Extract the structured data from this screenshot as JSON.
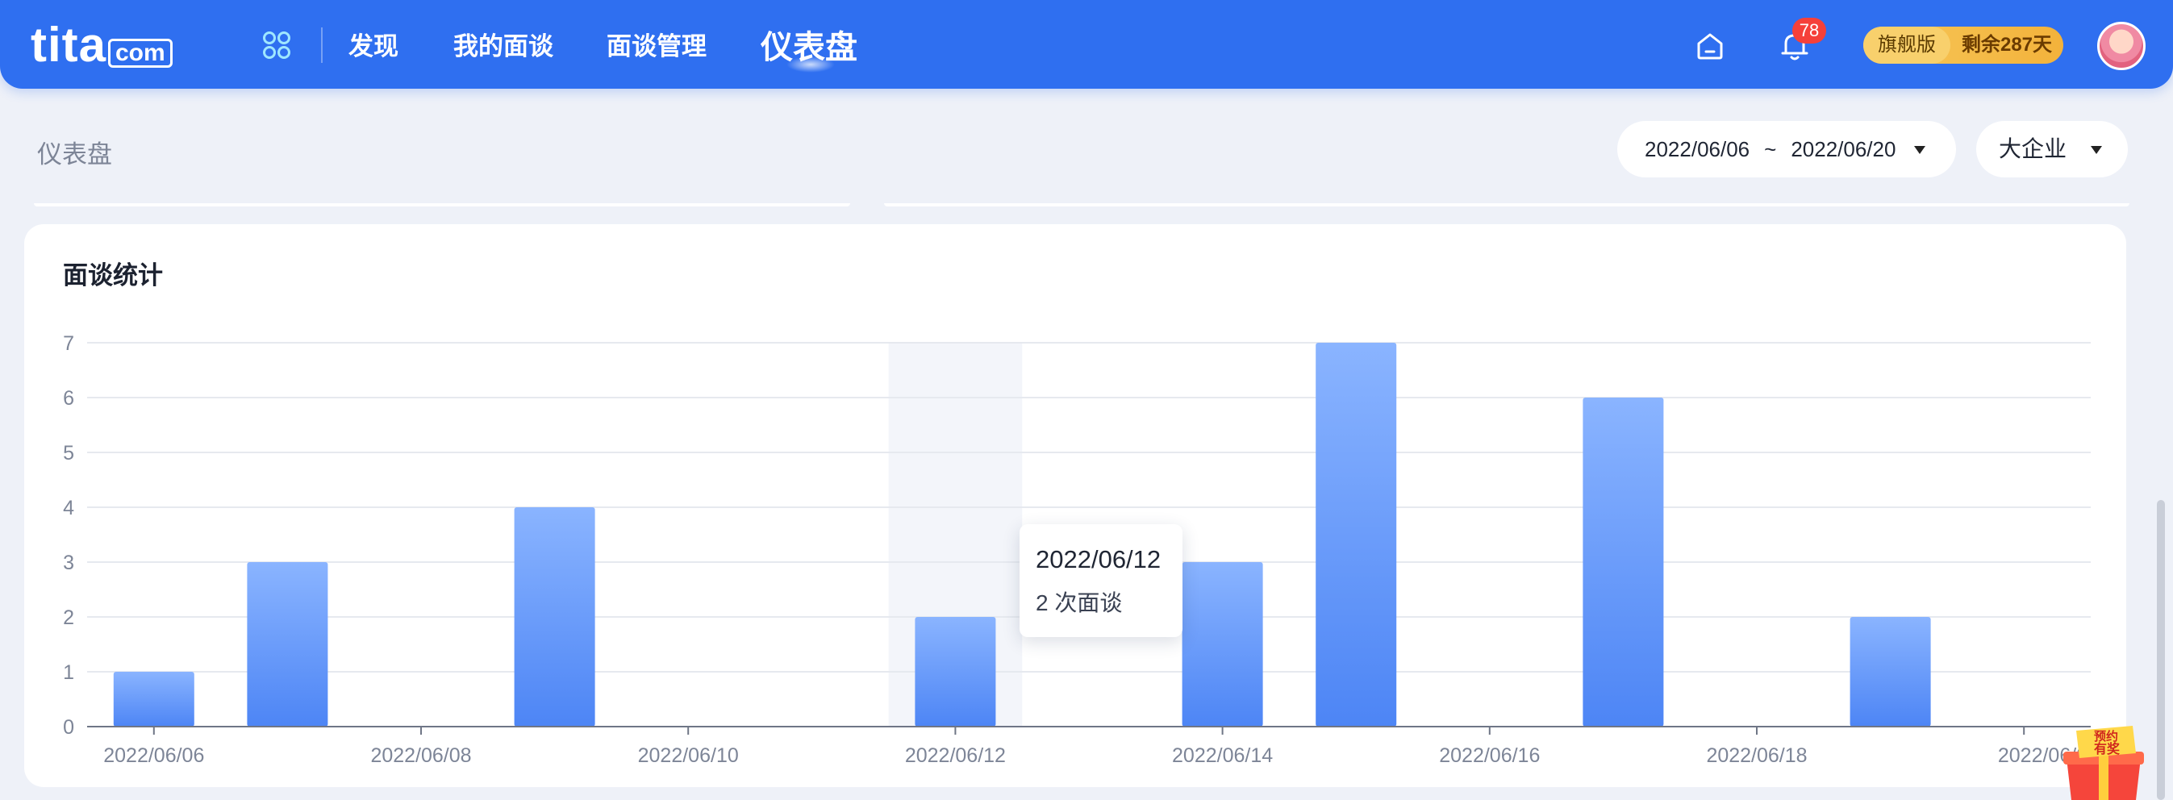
{
  "app": {
    "logo_main": "tita",
    "logo_sub": "com"
  },
  "nav": {
    "items": [
      {
        "label": "发现"
      },
      {
        "label": "我的面谈"
      },
      {
        "label": "面谈管理"
      },
      {
        "label": "仪表盘"
      }
    ],
    "notification_count": "78",
    "plan_name": "旗舰版",
    "plan_remaining": "剩余287天"
  },
  "page": {
    "title": "仪表盘",
    "date_start": "2022/06/06",
    "date_separator": "~",
    "date_end": "2022/06/20",
    "scope": "大企业"
  },
  "card": {
    "title": "面谈统计"
  },
  "tooltip": {
    "date": "2022/06/12",
    "value_text": "2 次面谈"
  },
  "promo": {
    "line1": "预约",
    "line2": "有奖"
  },
  "colors": {
    "nav_bg": "#2f6ff0",
    "bar_top": "#8ab4ff",
    "bar_bottom": "#4d85f5",
    "badge": "#f5403a",
    "plan_gold": "#f3b23b"
  },
  "chart_data": {
    "type": "bar",
    "title": "面谈统计",
    "categories": [
      "2022/06/06",
      "2022/06/07",
      "2022/06/08",
      "2022/06/09",
      "2022/06/10",
      "2022/06/11",
      "2022/06/12",
      "2022/06/13",
      "2022/06/14",
      "2022/06/15",
      "2022/06/16",
      "2022/06/17",
      "2022/06/18",
      "2022/06/19",
      "2022/06/20"
    ],
    "values": [
      1,
      3,
      0,
      4,
      0,
      0,
      2,
      0,
      3,
      7,
      0,
      6,
      0,
      2,
      0
    ],
    "x_tick_labels": [
      "2022/06/06",
      "2022/06/08",
      "2022/06/10",
      "2022/06/12",
      "2022/06/14",
      "2022/06/16",
      "2022/06/18",
      "2022/06/20"
    ],
    "y_ticks": [
      0,
      1,
      2,
      3,
      4,
      5,
      6,
      7
    ],
    "ylim": [
      0,
      7
    ],
    "grid": true,
    "highlighted_category": "2022/06/12"
  }
}
